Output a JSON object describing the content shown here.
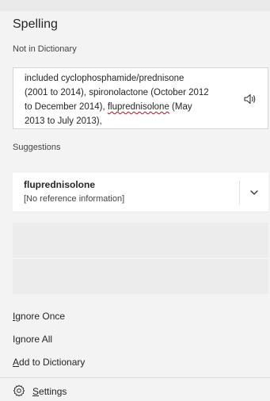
{
  "pane": {
    "title": "Spelling",
    "not_in_dictionary_label": "Not in Dictionary",
    "suggestions_label": "Suggestions"
  },
  "context": {
    "line1": "included cyclophosphamide/prednisone",
    "line2": "(2001 to 2014), spironolactone (October 2012",
    "line3_pre": "to December 2014), ",
    "misspelled_word": "fluprednisolone",
    "line3_post": " (May",
    "line4": "2013 to July 2013),"
  },
  "suggestion": {
    "word": "fluprednisolone",
    "info": "[No reference information]"
  },
  "actions": {
    "ignore_once": {
      "accel": "I",
      "rest": "gnore Once"
    },
    "ignore_all": {
      "pre": "I",
      "accel": "g",
      "rest": "nore All"
    },
    "add_to_dictionary": {
      "accel": "A",
      "rest": "dd to Dictionary"
    }
  },
  "settings": {
    "accel": "S",
    "rest": "ettings"
  },
  "colors": {
    "background": "#f3f3f3",
    "panel": "#ffffff",
    "misspelling_underline": "#d0021b"
  },
  "icons": {
    "speaker": "speaker-icon",
    "chevron": "chevron-down-icon",
    "settings": "gear-icon"
  }
}
